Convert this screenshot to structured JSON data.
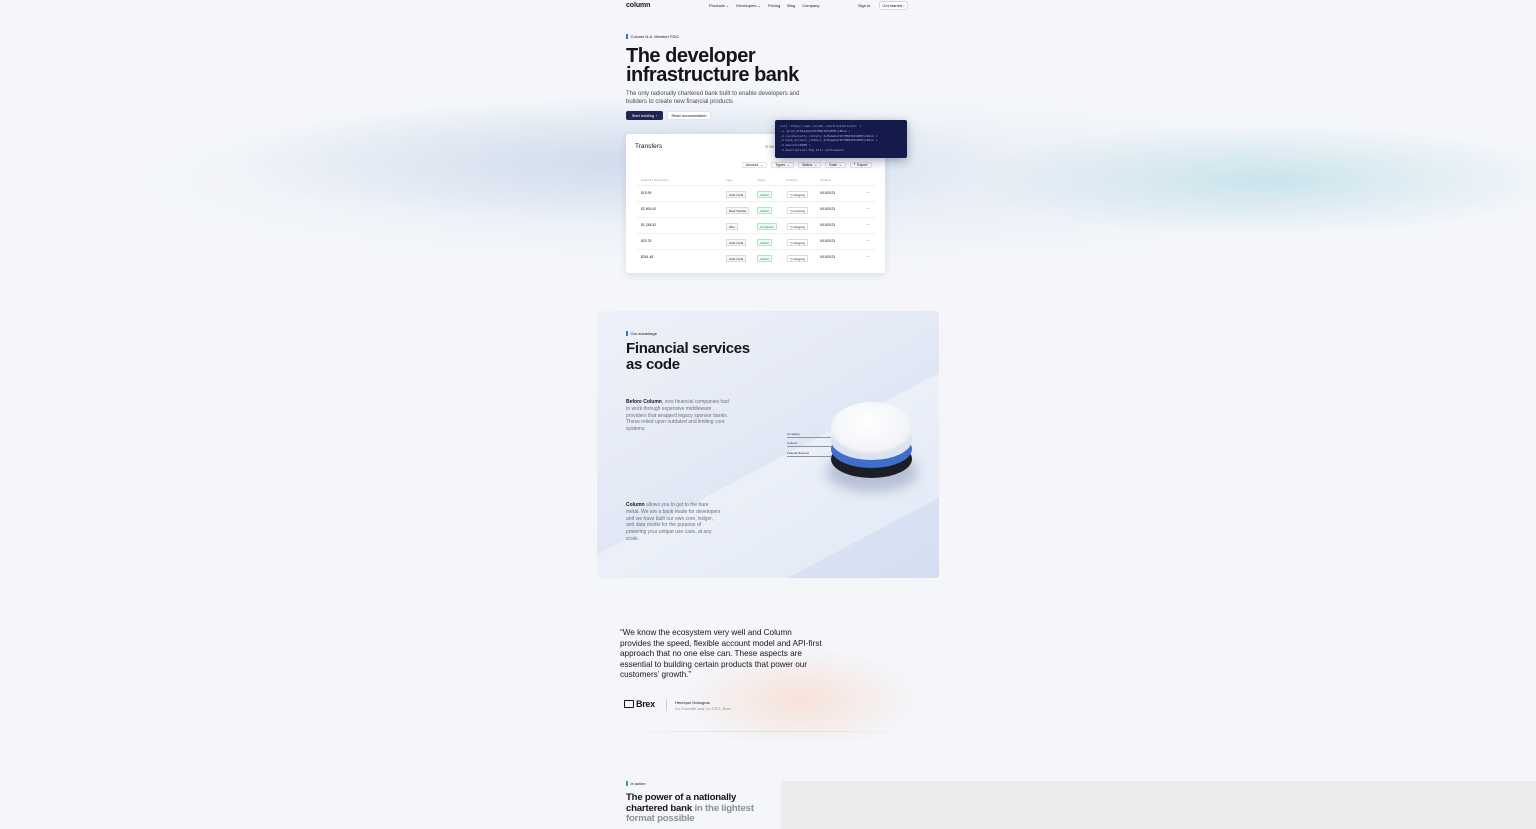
{
  "nav": {
    "logo": "column",
    "links": [
      "Products",
      "Developers",
      "Pricing",
      "Blog",
      "Company"
    ],
    "sign_in": "Sign in",
    "get_started": "Get started"
  },
  "hero": {
    "eyebrow": "Column N.A. Member FDIC",
    "title_line1": "The developer",
    "title_line2": "infrastructure bank",
    "subtitle": "The only nationally chartered bank built to enable developers and builders to create new financial products",
    "primary_button": "Start building",
    "secondary_button": "Read documentation"
  },
  "transfers": {
    "title": "Transfers",
    "search": "Se",
    "filters": [
      "Amount",
      "Types",
      "Status",
      "Date"
    ],
    "export": "Export",
    "columns": [
      "Amount / Description",
      "Type",
      "Status",
      "Direction",
      "Created"
    ],
    "rows": [
      {
        "amount": "$19.99",
        "type": "ACH Credit",
        "status": "Settled",
        "direction": "Outgoing",
        "created": "9/19/2023"
      },
      {
        "amount": "$2,500.00",
        "type": "Book Transfer",
        "status": "Settled",
        "direction": "Incoming",
        "created": "9/19/2023"
      },
      {
        "amount": "$1,248.52",
        "type": "Wire",
        "status": "Completed",
        "direction": "Outgoing",
        "created": "9/19/2023"
      },
      {
        "amount": "$20.78",
        "type": "ACH Credit",
        "status": "Settled",
        "direction": "Outgoing",
        "created": "9/19/2023"
      },
      {
        "amount": "$261.48",
        "type": "ACH Credit",
        "status": "Settled",
        "direction": "Outgoing",
        "created": "9/19/2023"
      }
    ]
  },
  "code": {
    "lines": [
      "curl 'https://api.column.com/transfers/ach' \\",
      "  -u :prod_5vHsqeKw7JK7MR4tDXdP5HiL8kxk \\",
      "  -d counterparty_id=cpty_2vHsqeKw7JK7MR4tDXdP5HiL8kxk \\",
      "  -d bank_account_id=bacc_2vHsqeKw7JK7MR4tDXdP5HiL8kxk \\",
      "  -d amount=10000 \\",
      "  -d description='Pay bill settlement'"
    ]
  },
  "advantage": {
    "eyebrow": "Our advantage",
    "title_line1": "Financial services",
    "title_line2": "as code",
    "p1_bold": "Before Column",
    "p1_rest": ", new financial companies had to work through expensive middleware providers that wrapped legacy sponsor banks. These relied upon outdated and limiting core systems.",
    "p2_bold": "Column",
    "p2_rest": " allows you to get to the bare metal. We are a bank made for developers and we have built our own core, ledger, and data model for the purpose of powering your unique use case, at any scale.",
    "layers": [
      "Company",
      "Column",
      "Federal Reserve"
    ]
  },
  "testimonial": {
    "quote": "“We know the ecosystem very well and Column provides the speed, flexible account model and API-first approach that no one else can. These aspects are essential to building certain products that power our customers’ growth.”",
    "company": "Brex",
    "person": "Henrique Dubugras",
    "role": "Co-Founder and Co-CEO, Brex"
  },
  "in_action": {
    "eyebrow": "In action",
    "title_bold": "The power of a nationally chartered bank",
    "title_muted": " in the lightest format possible"
  },
  "colors": {
    "accent_blue": "#3b6fd8",
    "navy": "#1e2552",
    "code_bg": "#141a4a",
    "green": "#2fa88a"
  }
}
